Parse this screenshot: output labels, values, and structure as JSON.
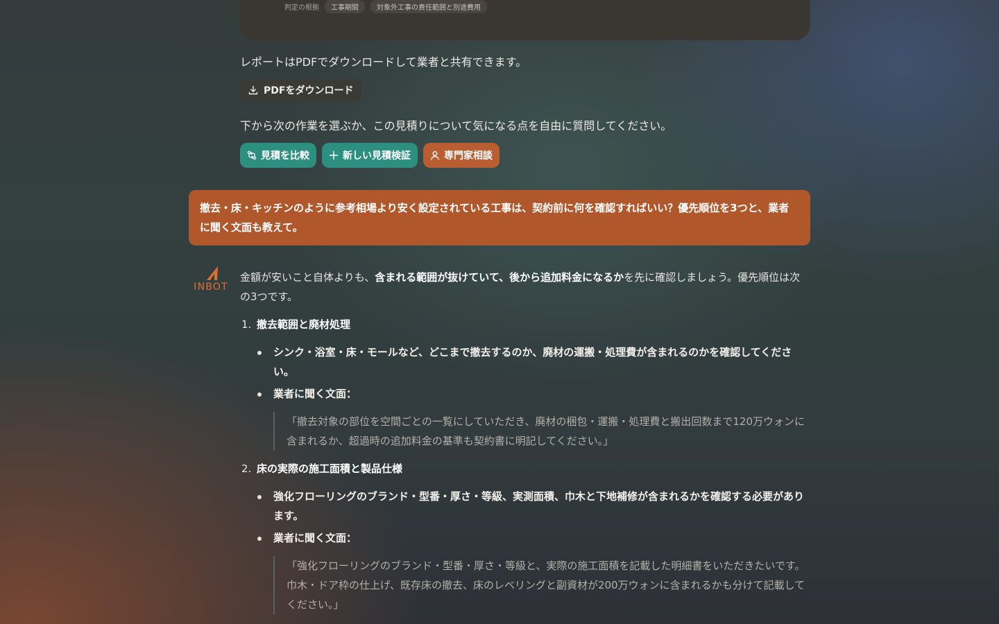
{
  "previous_card": {
    "label": "判定の根拠",
    "tags": [
      "工事期間",
      "対象外工事の責任範囲と別途費用"
    ]
  },
  "report_note": "レポートはPDFでダウンロードして業者と共有できます。",
  "pdf_button": {
    "label": "PDFをダウンロード",
    "icon": "download-icon"
  },
  "next_prompt": "下から次の作業を選ぶか、この見積りについて気になる点を自由に質問してください。",
  "actions": [
    {
      "label": "見積を比較",
      "icon": "compare-icon",
      "color": "#2c8f80"
    },
    {
      "label": "新しい見積検証",
      "icon": "plus-icon",
      "color": "#2c8f80"
    },
    {
      "label": "専門家相談",
      "icon": "person-icon",
      "color": "#b95d33"
    }
  ],
  "user_message": "撤去・床・キッチンのように参考相場より安く設定されている工事は、契約前に何を確認すればいい？優先順位を3つと、業者に聞く文面も教えて。",
  "bot": {
    "logo_text": "INBOT",
    "intro_before": "金額が安いこと自体よりも、",
    "intro_bold": "含まれる範囲が抜けていて、後から追加料金になるか",
    "intro_after": "を先に確認しましょう。優先順位は次の3つです。",
    "items": [
      {
        "number": "1.",
        "title": "撤去範囲と廃材処理",
        "point": "シンク・浴室・床・モールなど、どこまで撤去するのか、廃材の運搬・処理費が含まれるのかを確認してください。",
        "ask_label": "業者に聞く文面：",
        "quote": "「撤去対象の部位を空間ごとの一覧にしていただき、廃材の梱包・運搬・処理費と搬出回数まで120万ウォンに含まれるか、超過時の追加料金の基準も契約書に明記してください。」"
      },
      {
        "number": "2.",
        "title": "床の実際の施工面積と製品仕様",
        "point": "強化フローリングのブランド・型番・厚さ・等級、実測面積、巾木と下地補修が含まれるかを確認する必要があります。",
        "ask_label": "業者に聞く文面：",
        "quote": "「強化フローリングのブランド・型番・厚さ・等級と、実際の施工面積を記載した明細書をいただきたいです。巾木・ドア枠の仕上げ、既存床の撤去、床のレベリングと副資材が200万ウォンに含まれるかも分けて記載してください。」"
      }
    ]
  },
  "colors": {
    "accent_teal": "#2c8f80",
    "accent_orange": "#b0582c",
    "logo": "#e06f33"
  }
}
